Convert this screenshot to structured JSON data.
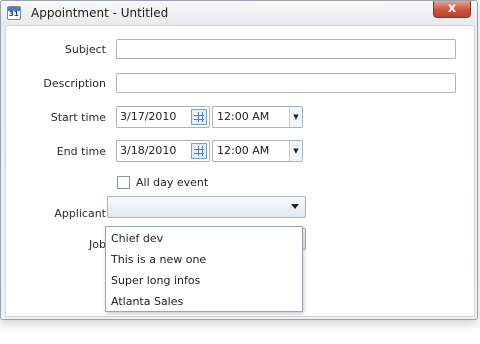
{
  "window": {
    "title": "Appointment - Untitled",
    "close_label": "x"
  },
  "form": {
    "subject": {
      "label": "Subject",
      "value": ""
    },
    "description": {
      "label": "Description",
      "value": ""
    },
    "start": {
      "label": "Start time",
      "date": "3/17/2010",
      "time": "12:00 AM"
    },
    "end": {
      "label": "End time",
      "date": "3/18/2010",
      "time": "12:00 AM"
    },
    "all_day": {
      "label": "All day event",
      "checked": false
    },
    "applicant": {
      "label": "Applicant",
      "value": ""
    },
    "job": {
      "label": "Job",
      "value": "",
      "options": [
        "Chief dev",
        "This is a new one",
        "Super long infos",
        "Atlanta Sales"
      ]
    }
  },
  "icons": {
    "app": "calendar-icon",
    "calendar_button": "calendar-icon",
    "spin": "chevron-down-icon",
    "combo_arrow": "chevron-down-icon",
    "close": "close-icon"
  },
  "icon_text": {
    "calendar_day": "31"
  }
}
